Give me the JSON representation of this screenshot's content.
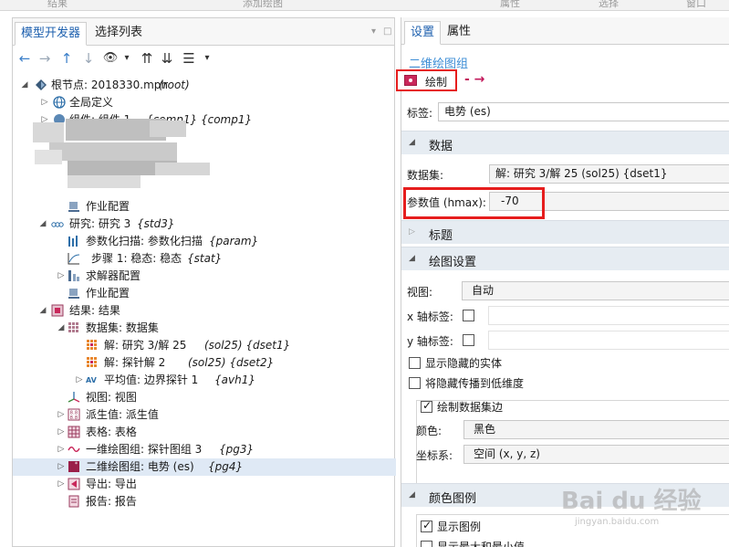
{
  "ribbon": [
    "结果",
    "添加绘图",
    "属性",
    "选择",
    "窗口"
  ],
  "left": {
    "tabs": [
      "模型开发器",
      "选择列表"
    ],
    "panel_controls": [
      "▾",
      "□"
    ],
    "toolbar": [
      "←",
      "→",
      "↑",
      "↓",
      "👁",
      "▾",
      "⇈",
      "⇊",
      "☰",
      "▾"
    ],
    "tree": [
      {
        "label": "根节点: 2018330.mph",
        "tag": "(root)"
      },
      {
        "label": "全局定义",
        "tag": ""
      },
      {
        "label": "组件: 组件 1",
        "tag": "{comp1} {comp1}"
      },
      {
        "label": "作业配置",
        "tag": ""
      },
      {
        "label": "研究: 研究 3",
        "tag": "{std3}"
      },
      {
        "label": "参数化扫描: 参数化扫描",
        "tag": "{param}"
      },
      {
        "label": "步骤 1: 稳态: 稳态",
        "tag": "{stat}"
      },
      {
        "label": "求解器配置",
        "tag": ""
      },
      {
        "label": "作业配置",
        "tag": ""
      },
      {
        "label": "结果: 结果",
        "tag": ""
      },
      {
        "label": "数据集: 数据集",
        "tag": ""
      },
      {
        "label": "解: 研究 3/解 25",
        "tag": "(sol25) {dset1}"
      },
      {
        "label": "解: 探针解 2",
        "tag": "(sol25) {dset2}"
      },
      {
        "label": "平均值: 边界探针 1",
        "tag": "{avh1}"
      },
      {
        "label": "视图: 视图",
        "tag": ""
      },
      {
        "label": "派生值: 派生值",
        "tag": ""
      },
      {
        "label": "表格: 表格",
        "tag": ""
      },
      {
        "label": "一维绘图组: 探针图组 3",
        "tag": "{pg3}"
      },
      {
        "label": "二维绘图组: 电势 (es)",
        "tag": "{pg4}"
      },
      {
        "label": "导出: 导出",
        "tag": ""
      },
      {
        "label": "报告: 报告",
        "tag": ""
      }
    ]
  },
  "right": {
    "tabs": [
      "设置",
      "属性"
    ],
    "group_title": "二维绘图组",
    "plot_button": "绘制",
    "label_field": {
      "label": "标签:",
      "value": "电势 (es)"
    },
    "sections": {
      "data": "数据",
      "title": "标题",
      "plot_settings": "绘图设置",
      "color_legend": "颜色图例"
    },
    "dataset": {
      "label": "数据集:",
      "value": "解: 研究 3/解 25 (sol25) {dset1}"
    },
    "param": {
      "label": "参数值 (hmax):",
      "value": "-70"
    },
    "view": {
      "label": "视图:",
      "value": "自动"
    },
    "x_label": "x 轴标签:",
    "y_label": "y 轴标签:",
    "show_hidden": "显示隐藏的实体",
    "propagate_hidden": "将隐藏传播到低维度",
    "draw_edges": "绘制数据集边",
    "color": {
      "label": "颜色:",
      "value": "黑色"
    },
    "frame": {
      "label": "坐标系:",
      "value": "空间 (x, y, z)"
    },
    "show_legend": "显示图例",
    "show_minmax": "显示最大和最小值"
  },
  "watermark": {
    "main": "Bai du 经验",
    "sub": "jingyan.baidu.com"
  },
  "colors": {
    "accent": "#1c5fae",
    "highlight": "#e61d1d",
    "section_bg": "#e6ecf2"
  }
}
